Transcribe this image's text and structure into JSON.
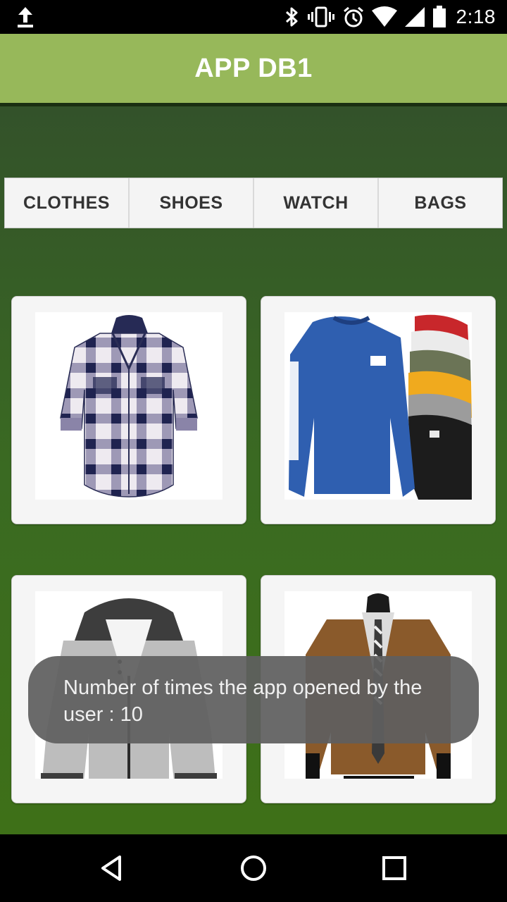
{
  "status_bar": {
    "time": "2:18",
    "icons": [
      "upload-icon",
      "bluetooth-icon",
      "vibrate-icon",
      "alarm-icon",
      "wifi-icon",
      "signal-icon",
      "battery-icon"
    ]
  },
  "app_bar": {
    "title": "APP DB1"
  },
  "tabs": [
    {
      "label": "CLOTHES"
    },
    {
      "label": "SHOES"
    },
    {
      "label": "WATCH"
    },
    {
      "label": "BAGS"
    }
  ],
  "products": [
    {
      "image": "plaid-hooded-shirt"
    },
    {
      "image": "cat-caterpillar-long-sleeve-tees"
    },
    {
      "image": "grey-hooded-jacket"
    },
    {
      "image": "brown-pea-coat"
    }
  ],
  "toast": {
    "message": "Number of times the app opened by the user : 10"
  },
  "nav_bar": {
    "buttons": [
      "back-icon",
      "home-icon",
      "recents-icon"
    ]
  }
}
